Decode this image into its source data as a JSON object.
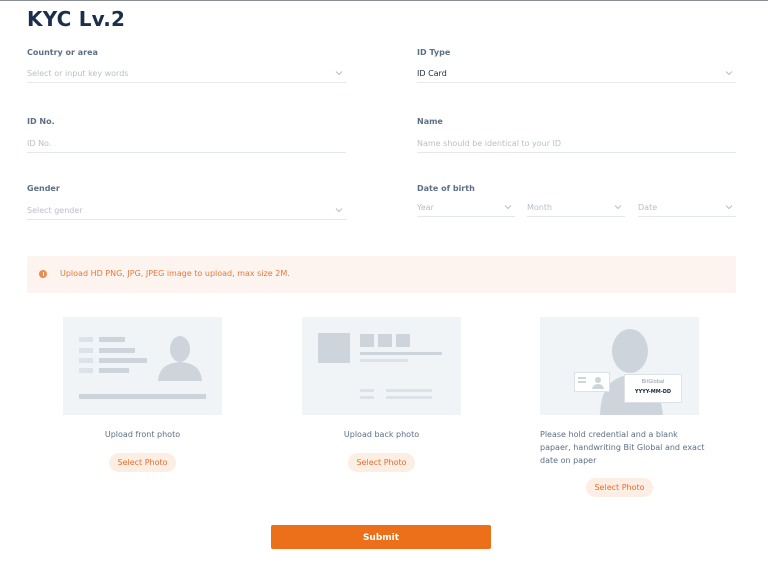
{
  "page": {
    "title": "KYC Lv.2"
  },
  "form": {
    "country": {
      "label": "Country or area",
      "placeholder": "Select or input key words"
    },
    "id_type": {
      "label": "ID Type",
      "value": "ID Card"
    },
    "id_no": {
      "label": "ID No.",
      "placeholder": "ID No."
    },
    "name": {
      "label": "Name",
      "placeholder": "Name should be identical to your ID"
    },
    "gender": {
      "label": "Gender",
      "placeholder": "Select gender"
    },
    "dob": {
      "label": "Date of birth",
      "year": "Year",
      "month": "Month",
      "date": "Date"
    }
  },
  "notice": {
    "text": "Upload HD PNG, JPG, JPEG image to upload, max size 2M."
  },
  "uploads": {
    "front": {
      "caption": "Upload front photo",
      "button": "Select Photo"
    },
    "back": {
      "caption": "Upload back photo",
      "button": "Select Photo"
    },
    "hold": {
      "caption_lines": [
        "Please hold credential and a blank",
        "papaer, handwriting Bit Global and exact",
        "date on paper"
      ],
      "button": "Select Photo",
      "paper_title": "BitGlobal",
      "paper_date": "YYYY-MM-DD"
    }
  },
  "submit_label": "Submit",
  "colors": {
    "accent": "#ec6f1a",
    "title": "#1b2f4b",
    "placeholder": "#b9bfc7",
    "notice_bg": "#fdf4ef"
  }
}
